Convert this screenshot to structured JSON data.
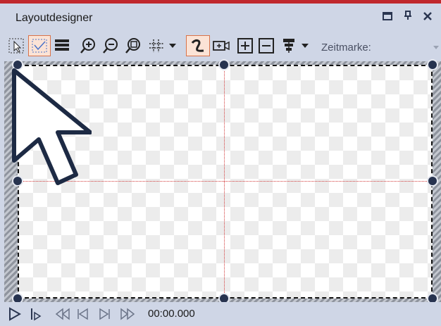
{
  "panel": {
    "title": "Layoutdesigner"
  },
  "window_buttons": [
    "maximize-icon",
    "pin-icon",
    "close-icon"
  ],
  "toolbar": {
    "zeitmarke_label": "Zeitmarke:",
    "tools": [
      "select-icon",
      "frame-icon",
      "lines-icon",
      "zoom-in-icon",
      "zoom-out-icon",
      "zoom-fit-icon",
      "grid-icon",
      "curve-icon",
      "camera-icon",
      "add-icon",
      "remove-icon",
      "align-icon"
    ]
  },
  "playback": {
    "time": "00:00.000"
  },
  "colors": {
    "accent": "#c0282d",
    "guide": "#d23b3b",
    "handle": "#27334f",
    "panel": "#cfd6e6"
  }
}
